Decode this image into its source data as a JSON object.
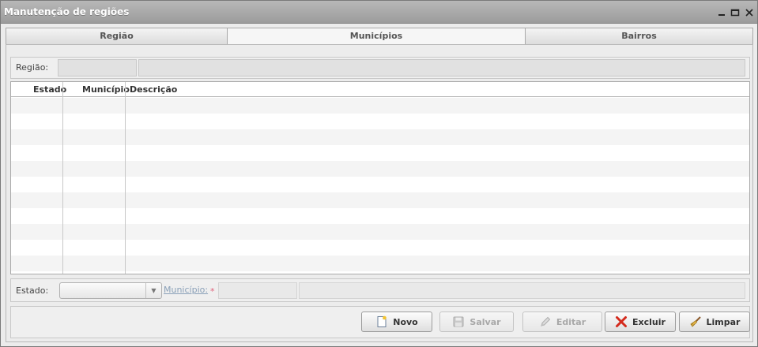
{
  "window": {
    "title": "Manutenção de regiões",
    "minimize_icon": "minimize-icon",
    "maximize_icon": "maximize-icon",
    "close_icon": "close-icon"
  },
  "tabs": [
    {
      "label": "Região",
      "active": false
    },
    {
      "label": "Municípios",
      "active": true
    },
    {
      "label": "Bairros",
      "active": false
    }
  ],
  "regiao_panel": {
    "label": "Região:",
    "code_value": "",
    "name_value": ""
  },
  "grid": {
    "columns": [
      "Estado",
      "Município",
      "Descrição"
    ],
    "rows": []
  },
  "filter_panel": {
    "estado_label": "Estado:",
    "estado_value": "",
    "municipio_label": "Município:",
    "required_mark": "*",
    "municipio_code": "",
    "municipio_name": ""
  },
  "buttons": {
    "novo": {
      "label": "Novo",
      "icon": "new-document-icon",
      "enabled": true
    },
    "salvar": {
      "label": "Salvar",
      "icon": "save-disk-icon",
      "enabled": false
    },
    "editar": {
      "label": "Editar",
      "icon": "pencil-icon",
      "enabled": false
    },
    "excluir": {
      "label": "Excluir",
      "icon": "red-x-icon",
      "enabled": true
    },
    "limpar": {
      "label": "Limpar",
      "icon": "broom-icon",
      "enabled": true
    }
  }
}
